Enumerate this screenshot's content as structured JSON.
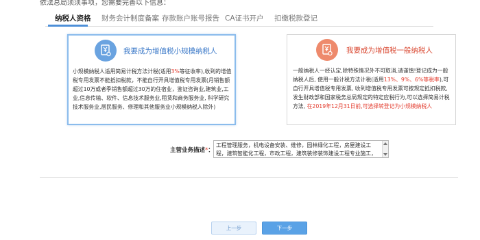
{
  "notice": "依法总局须须事项，您需要完善以下信息：",
  "tabs": [
    {
      "label": "纳税人资格",
      "active": true
    },
    {
      "label": "财务会计制度备案",
      "active": false
    },
    {
      "label": "存款账户账号报告",
      "active": false
    },
    {
      "label": "CA证书开户",
      "active": false
    },
    {
      "label": "扣缴税款登记",
      "active": false
    }
  ],
  "small_taxpayer": {
    "title": "我要成为增值税小规模纳税人",
    "icon": "taxpayer-document-icon",
    "body_1": "小规模纳税人适用简易计税方法计税(适用",
    "body_rate": "3%",
    "body_2": "等征收率),收到的增值税专用发票不能抵扣税款，不能自行开具增值税专用发票(月销售额超过10万或者季销售额超过30万的住宿业，鉴证咨询业,建筑业,工业,信息传输、软件、信息技术服务业,租赁和商务服务业, 科学研究技术服务业,居民服务、修理和其他服务业小规模纳税人除外)"
  },
  "general_taxpayer": {
    "title": "我要成为增值税一般纳税人",
    "icon": "taxpayer-document-icon",
    "body_1": "一般纳税人一经认定,除特殊情况外不可取消,请谨慎!登记成为一般纳税人后, 使用一般计税方法计税(适用",
    "body_rates": "13%、9%、6%等税率",
    "body_2": "),可自行开具增值税专用发票, 收到增值税专用发票可按规定抵扣税款,发生财政部和国家税务总局规定的特定应税行为,可以选择简易计税方法, ",
    "body_deadline": "在2019年12月31日前,可选择转登记为小规模纳税人"
  },
  "business_description": {
    "label": "主营业务描述",
    "required_mark": "*",
    "colon": "：",
    "value": "工程管理服务，机电设备安装、维修，园林绿化工程，房屋建设工程，建筑智能化工程，市政工程，建筑装修装饰建设工程专业施工，地基与基础"
  },
  "buttons": {
    "prev": "上一步",
    "next": "下一步"
  },
  "colors": {
    "accent_blue": "#5aa2e6",
    "highlight_red": "#e33b2d",
    "small_badge": "#6aa3e0",
    "general_badge": "#ee8a6c"
  }
}
